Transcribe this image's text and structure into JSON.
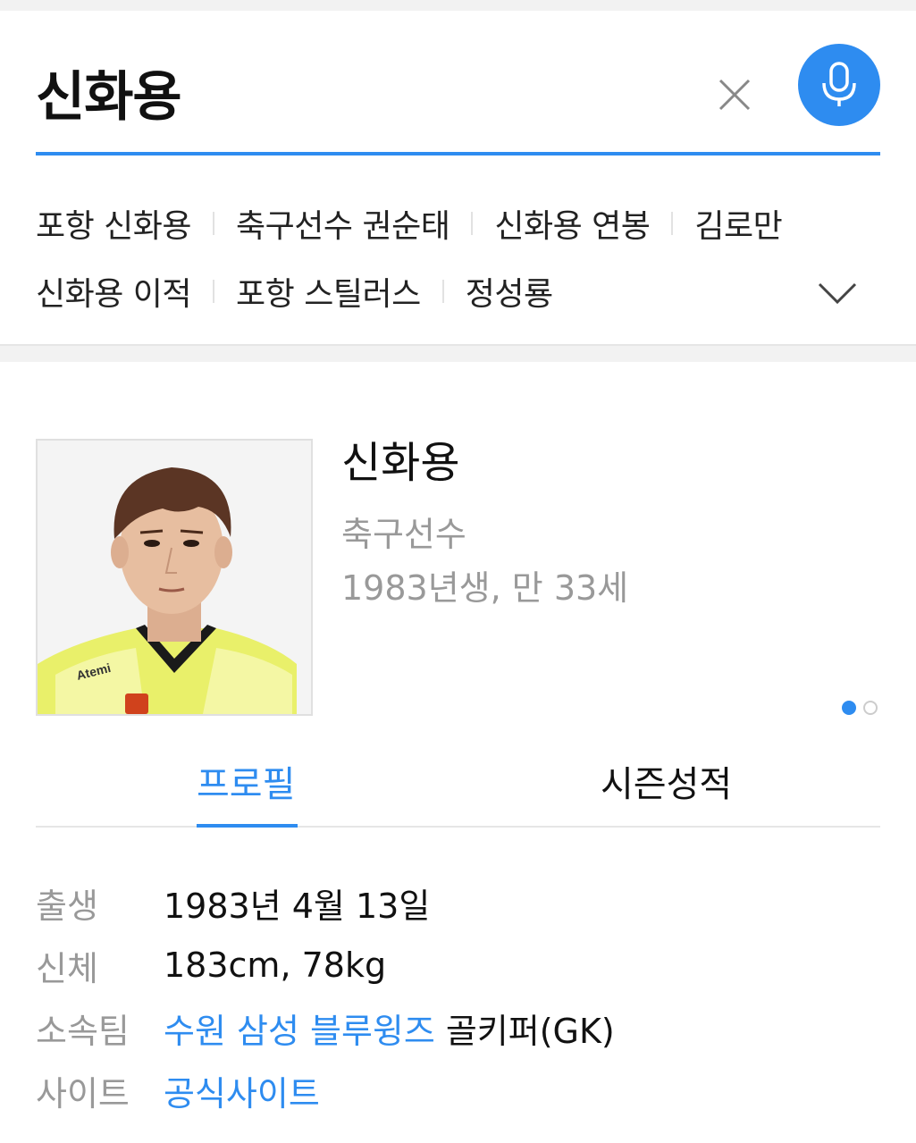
{
  "search": {
    "query": "신화용"
  },
  "related": {
    "row1": [
      "포항 신화용",
      "축구선수 권순태",
      "신화용 연봉",
      "김로만"
    ],
    "row2": [
      "신화용 이적",
      "포항 스틸러스",
      "정성룡"
    ]
  },
  "profile": {
    "name": "신화용",
    "occupation": "축구선수",
    "age": "1983년생, 만 33세",
    "jersey_text": "Atemi"
  },
  "tabs": {
    "profile": "프로필",
    "season": "시즌성적"
  },
  "info": {
    "birth_label": "출생",
    "birth_value": "1983년 4월 13일",
    "body_label": "신체",
    "body_value": "183cm, 78kg",
    "team_label": "소속팀",
    "team_link": "수원 삼성 블루윙즈",
    "team_position": "골키퍼(GK)",
    "site_label": "사이트",
    "site_link": "공식사이트"
  },
  "colors": {
    "accent": "#2e8cf0",
    "muted": "#999999",
    "text": "#111111"
  },
  "icons": {
    "clear": "close-icon",
    "mic": "microphone-icon",
    "expand": "chevron-down-icon"
  }
}
